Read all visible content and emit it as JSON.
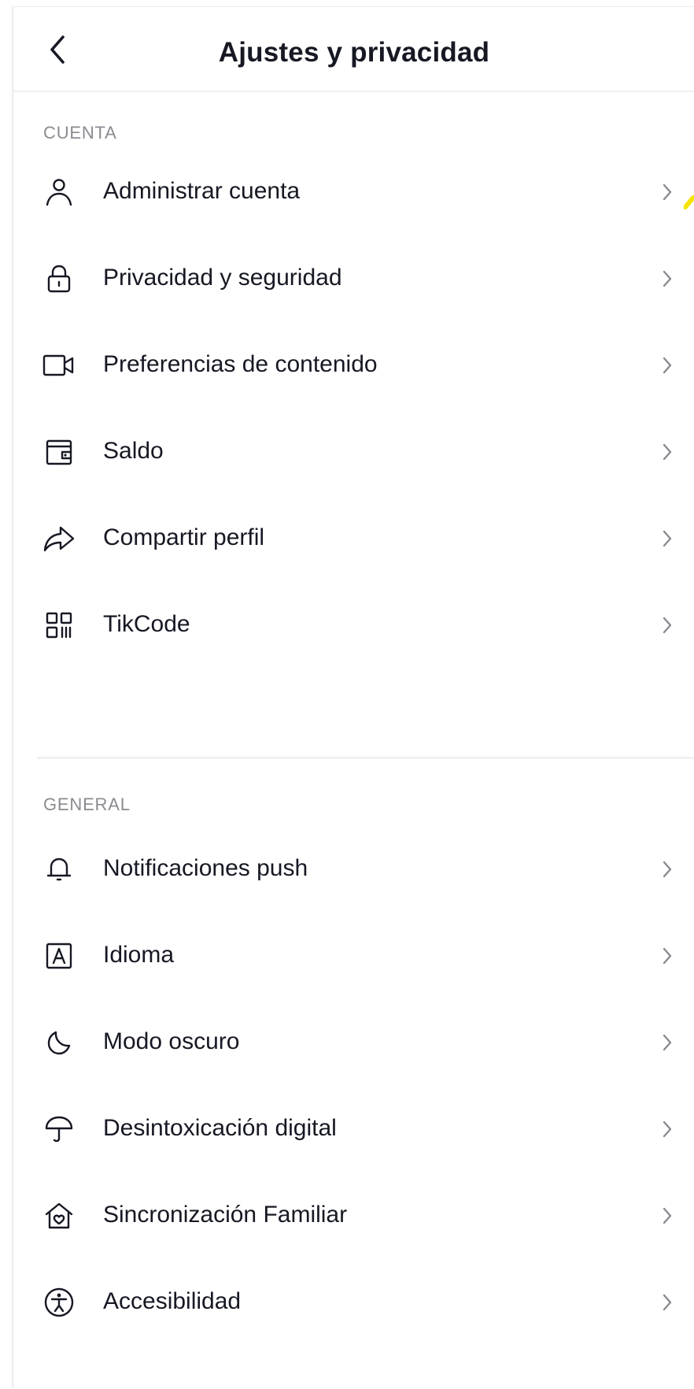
{
  "header": {
    "title": "Ajustes y privacidad",
    "back_icon": "chevron-left-icon"
  },
  "sections": [
    {
      "label": "CUENTA",
      "items": [
        {
          "label": "Administrar cuenta",
          "icon": "person-icon"
        },
        {
          "label": "Privacidad y seguridad",
          "icon": "lock-icon"
        },
        {
          "label": "Preferencias de contenido",
          "icon": "video-camera-icon"
        },
        {
          "label": "Saldo",
          "icon": "wallet-icon"
        },
        {
          "label": "Compartir perfil",
          "icon": "share-icon"
        },
        {
          "label": "TikCode",
          "icon": "qr-code-icon"
        }
      ]
    },
    {
      "label": "GENERAL",
      "items": [
        {
          "label": "Notificaciones push",
          "icon": "bell-icon"
        },
        {
          "label": "Idioma",
          "icon": "language-icon"
        },
        {
          "label": "Modo oscuro",
          "icon": "moon-icon"
        },
        {
          "label": "Desintoxicación digital",
          "icon": "umbrella-icon"
        },
        {
          "label": "Sincronización Familiar",
          "icon": "family-home-icon"
        },
        {
          "label": "Accesibilidad",
          "icon": "accessibility-icon"
        }
      ]
    }
  ],
  "colors": {
    "text": "#161823",
    "section_label": "#8a8b91",
    "chevron": "#8a8b91",
    "divider": "#f1f1f2",
    "accent_mark": "#f5e400"
  }
}
